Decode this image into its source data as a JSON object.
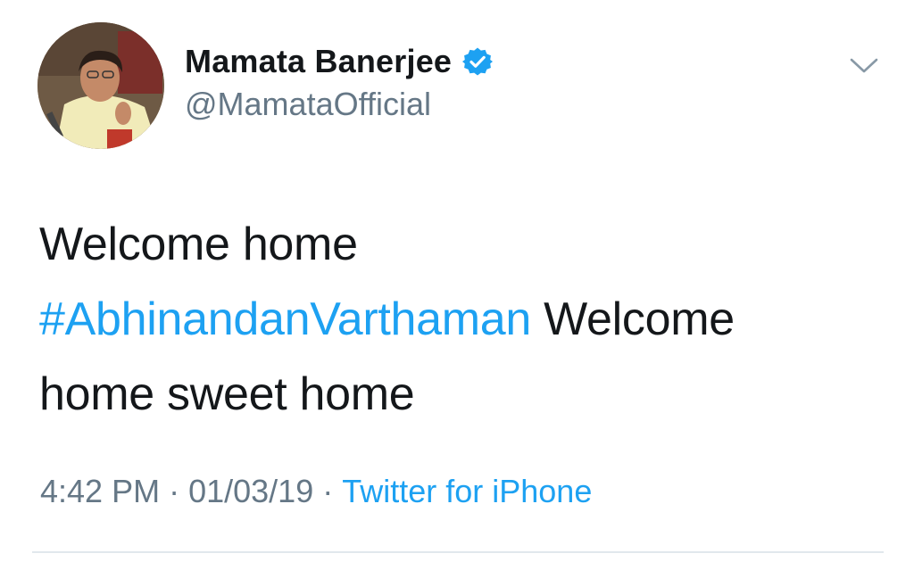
{
  "author": {
    "display_name": "Mamata Banerjee",
    "handle": "@MamataOfficial",
    "verified": true,
    "verified_icon": "verified-badge-icon",
    "avatar_icon": "profile-photo"
  },
  "menu": {
    "icon": "chevron-down-icon"
  },
  "tweet": {
    "text_part1": "Welcome home ",
    "hashtag": "#AbhinandanVarthaman",
    "text_part2": " Welcome home sweet home"
  },
  "meta": {
    "time": "4:42 PM",
    "separator": "·",
    "date": "01/03/19",
    "source": "Twitter for iPhone"
  },
  "colors": {
    "link": "#1da1f2",
    "text": "#14171a",
    "secondary": "#657786",
    "divider": "#e1e8ed"
  }
}
